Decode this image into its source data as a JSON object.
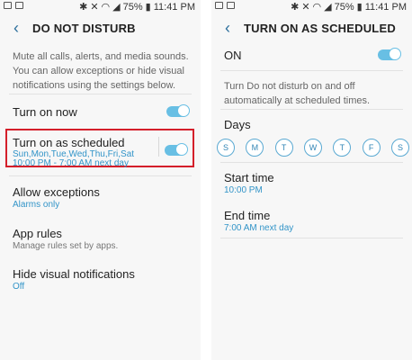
{
  "statusbar": {
    "battery_percent": "75%",
    "time": "11:41 PM"
  },
  "left": {
    "title": "DO NOT DISTURB",
    "description": "Mute all calls, alerts, and media sounds. You can allow exceptions or hide visual notifications using the settings below.",
    "turn_on_now": {
      "label": "Turn on now",
      "enabled": true
    },
    "turn_on_as_scheduled": {
      "label": "Turn on as scheduled",
      "days": "Sun,Mon,Tue,Wed,Thu,Fri,Sat",
      "time": "10:00 PM - 7:00 AM next day",
      "enabled": true
    },
    "allow_exceptions": {
      "label": "Allow exceptions",
      "value": "Alarms only"
    },
    "app_rules": {
      "label": "App rules",
      "value": "Manage rules set by apps."
    },
    "hide_visual": {
      "label": "Hide visual notifications",
      "value": "Off"
    }
  },
  "right": {
    "title": "TURN ON AS SCHEDULED",
    "on_label": "ON",
    "on_enabled": true,
    "description": "Turn Do not disturb on and off automatically at scheduled times.",
    "days_label": "Days",
    "days": [
      "S",
      "M",
      "T",
      "W",
      "T",
      "F",
      "S"
    ],
    "start_time": {
      "label": "Start time",
      "value": "10:00 PM"
    },
    "end_time": {
      "label": "End time",
      "value": "7:00 AM next day"
    }
  },
  "colors": {
    "accent": "#3294c8",
    "toggle": "#68bfe4",
    "highlight": "#d41f2a"
  }
}
